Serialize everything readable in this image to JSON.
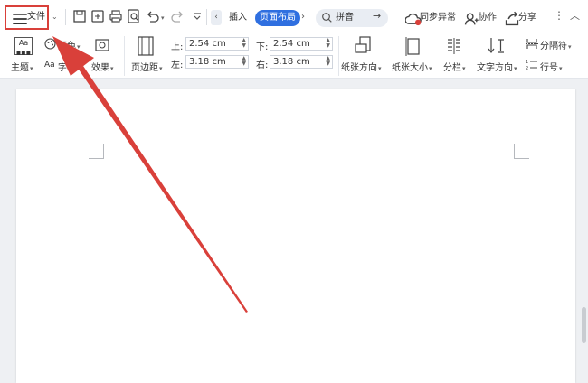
{
  "toolbar": {
    "file_label": "文件",
    "insert_tab": "插入",
    "page_layout_tab": "页面布局",
    "search_label": "拼音",
    "sync_label": "同步异常",
    "collab_label": "协作",
    "share_label": "分享"
  },
  "ribbon": {
    "theme_label": "主题",
    "color_label": "颜色",
    "font_label": "字体",
    "effect_label": "效果",
    "margins_label": "页边距",
    "top_label": "上:",
    "top_value": "2.54 cm",
    "bottom_label": "下:",
    "bottom_value": "2.54 cm",
    "left_label": "左:",
    "left_value": "3.18 cm",
    "right_label": "右:",
    "right_value": "3.18 cm",
    "orientation_label": "纸张方向",
    "size_label": "纸张大小",
    "columns_label": "分栏",
    "text_direction_label": "文字方向",
    "separator_label": "分隔符",
    "line_number_label": "行号"
  },
  "colors": {
    "accent": "#2f6fe0",
    "annotation": "#d9403a"
  }
}
